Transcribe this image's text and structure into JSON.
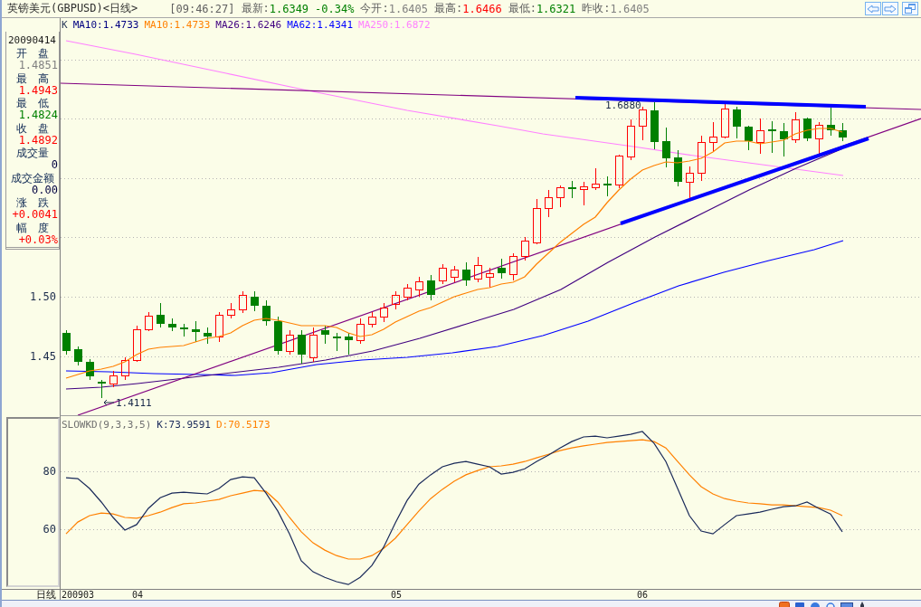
{
  "header": {
    "title": "英镑美元(GBPUSD)<日线>",
    "time": "[09:46:27]",
    "quotes": [
      {
        "label": "最新:",
        "value": "1.6349",
        "change": "-0.34%",
        "color": "#008000"
      },
      {
        "label": "今开:",
        "value": "1.6405",
        "color": "#808080"
      },
      {
        "label": "最高:",
        "value": "1.6466",
        "color": "#ff0000"
      },
      {
        "label": "最低:",
        "value": "1.6321",
        "color": "#008000"
      },
      {
        "label": "昨收:",
        "value": "1.6405",
        "color": "#808080"
      }
    ]
  },
  "price_chart": {
    "symbol": "K",
    "moving_averages": [
      {
        "label": "MA10:1.4733",
        "color": "#000080"
      },
      {
        "label": "MA10:1.4733",
        "color": "#ff8000"
      },
      {
        "label": "MA26:1.6246",
        "color": "#400080"
      },
      {
        "label": "MA62:1.4341",
        "color": "#0000ff"
      },
      {
        "label": "MA250:1.6872",
        "color": "#ff80ff"
      }
    ],
    "y_ticks": [
      "1.50",
      "1.45"
    ],
    "high_marker": "1.6880",
    "low_marker": "1.4111"
  },
  "info_panel": {
    "date": "20090414",
    "fields": [
      {
        "label": "开　盘",
        "value": "1.4851",
        "color": "#808080"
      },
      {
        "label": "最　高",
        "value": "1.4943",
        "color": "#ff0000"
      },
      {
        "label": "最　低",
        "value": "1.4824",
        "color": "#008000"
      },
      {
        "label": "收　盘",
        "value": "1.4892",
        "color": "#ff0000"
      },
      {
        "label": "成交量",
        "value": "0",
        "color": "#000040"
      },
      {
        "label": "成交金额",
        "value": "0.00",
        "color": "#000040"
      },
      {
        "label": "涨　跌",
        "value": "+0.0041",
        "color": "#ff0000"
      },
      {
        "label": "幅　度",
        "value": "+0.03%",
        "color": "#ff0000"
      }
    ]
  },
  "indicator_panel": {
    "chart_data": {
      "type": "line",
      "title": "SLOWKD(9,3,3,5)",
      "ylim": [
        39.7,
        99.1
      ],
      "yticks": [
        80,
        60
      ],
      "series": [
        {
          "name": "K:73.9591",
          "color": "#1a2a5a",
          "values": [
            77.8,
            77.5,
            74.1,
            69.4,
            64.1,
            59.7,
            61.6,
            67.2,
            70.9,
            72.5,
            72.8,
            72.5,
            72.2,
            74.1,
            77.2,
            78.1,
            77.8,
            72.5,
            66.3,
            58.4,
            49.1,
            45.3,
            43.4,
            41.9,
            40.9,
            43.4,
            47.5,
            53.8,
            62.2,
            70.0,
            75.6,
            78.8,
            81.6,
            82.8,
            83.4,
            82.5,
            81.6,
            79.1,
            79.7,
            80.9,
            83.4,
            85.6,
            88.1,
            90.3,
            91.9,
            92.2,
            91.6,
            92.2,
            92.8,
            93.8,
            89.7,
            83.4,
            74.1,
            64.7,
            59.4,
            58.4,
            61.6,
            64.7,
            65.3,
            65.9,
            66.9,
            67.8,
            68.1,
            69.4,
            67.2,
            65.3,
            59.1
          ]
        },
        {
          "name": "D:70.5173",
          "color": "#ff8000",
          "values": [
            58.4,
            62.5,
            64.7,
            65.6,
            65.3,
            64.1,
            63.8,
            64.7,
            65.9,
            67.5,
            68.8,
            69.1,
            69.7,
            70.3,
            71.6,
            72.5,
            73.4,
            73.1,
            69.4,
            64.1,
            59.1,
            55.3,
            52.8,
            50.9,
            49.7,
            49.7,
            50.9,
            53.4,
            56.9,
            61.6,
            66.3,
            70.6,
            73.8,
            76.6,
            78.8,
            80.3,
            81.6,
            81.9,
            82.5,
            83.4,
            84.7,
            85.9,
            87.2,
            88.1,
            88.8,
            89.4,
            90.0,
            90.3,
            90.6,
            90.9,
            90.3,
            88.1,
            83.4,
            78.8,
            74.7,
            72.2,
            70.6,
            69.7,
            69.1,
            68.8,
            68.4,
            68.4,
            68.1,
            67.8,
            67.5,
            66.6,
            64.7
          ]
        }
      ]
    }
  },
  "date_axis": {
    "period": "日线",
    "ticks": [
      "200903",
      "04",
      "05",
      "06"
    ]
  }
}
